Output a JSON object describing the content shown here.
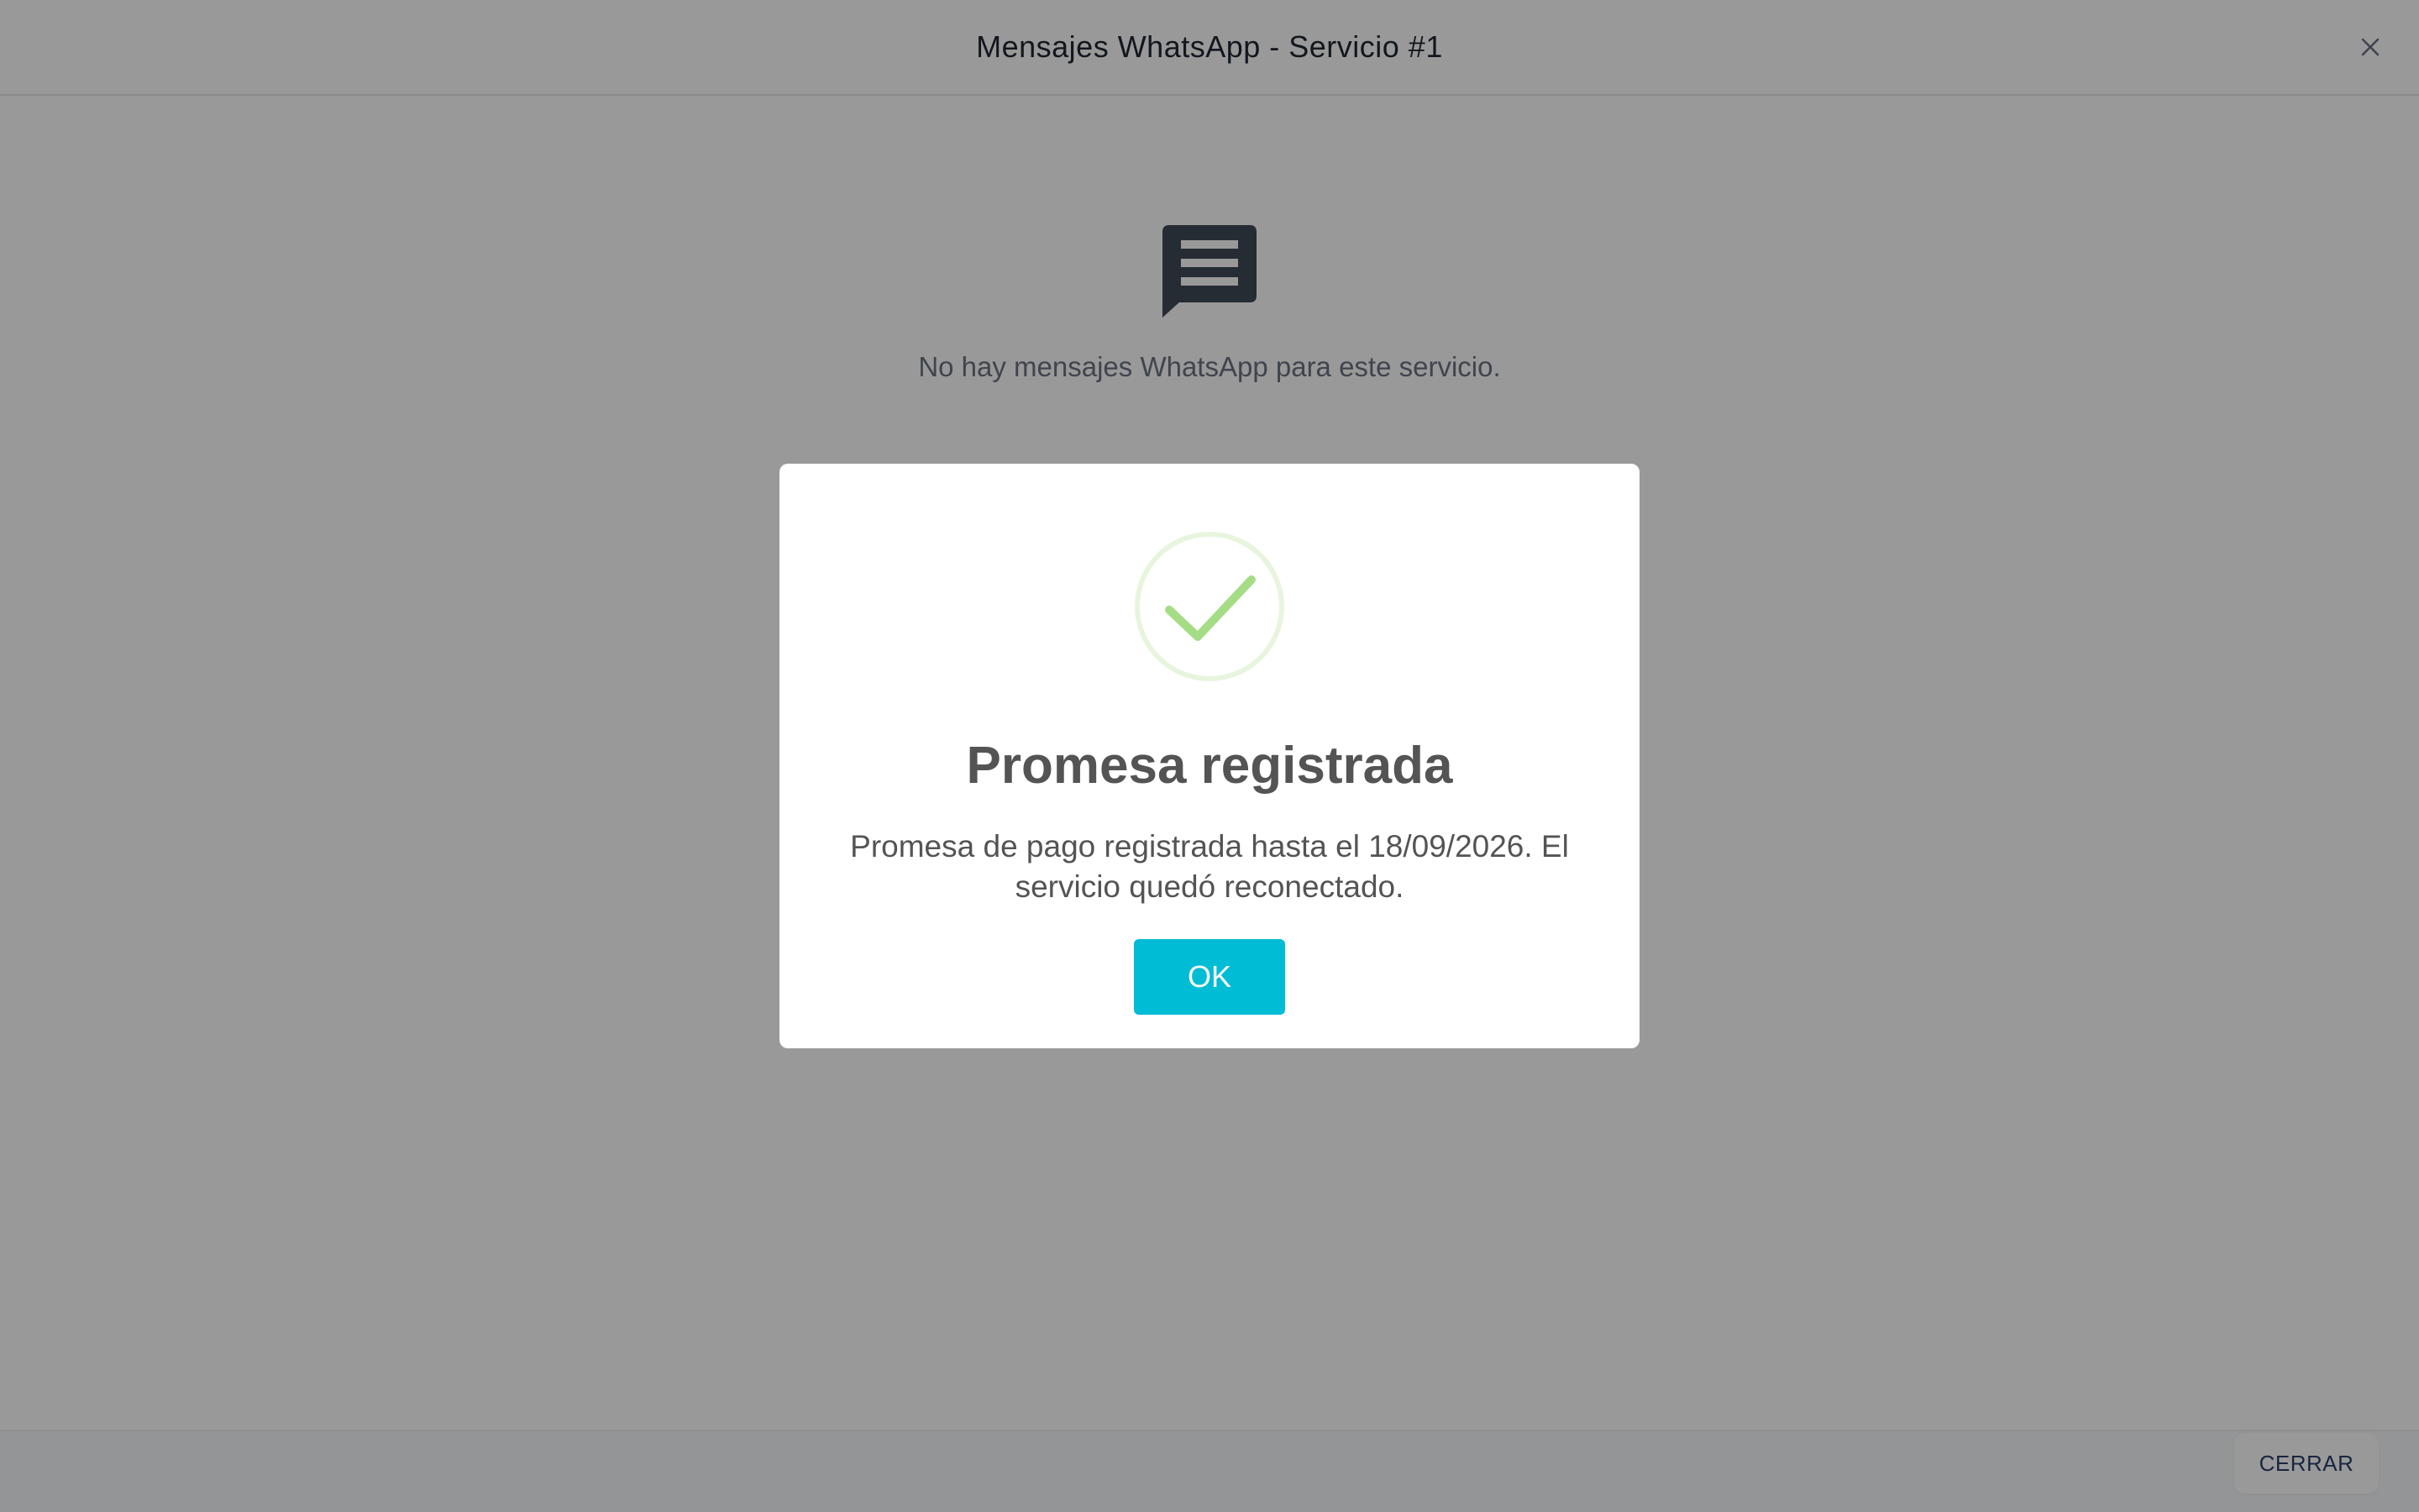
{
  "modal": {
    "title": "Mensajes WhatsApp - Servicio #1",
    "close_icon": "close-icon",
    "empty_icon": "message-icon",
    "empty_text": "No hay mensajes WhatsApp para este servicio.",
    "footer_button": "CERRAR"
  },
  "alert": {
    "icon": "success-check-icon",
    "title": "Promesa registrada",
    "text": "Promesa de pago registrada hasta el 18/09/2026. El servicio quedó reconectado.",
    "ok_label": "OK"
  },
  "colors": {
    "accent": "#00bcd4",
    "success": "#a5dc86",
    "overlay": "rgba(0,0,0,0.4)"
  }
}
